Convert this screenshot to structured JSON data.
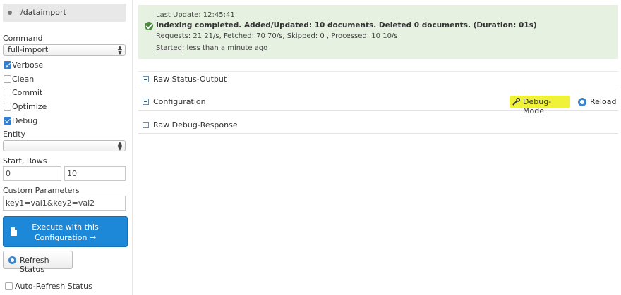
{
  "sidebar": {
    "core_name": "/dataimport",
    "command_label": "Command",
    "command_value": "full-import",
    "checkboxes": [
      {
        "label": "Verbose",
        "checked": true
      },
      {
        "label": "Clean",
        "checked": false
      },
      {
        "label": "Commit",
        "checked": false
      },
      {
        "label": "Optimize",
        "checked": false
      },
      {
        "label": "Debug",
        "checked": true
      }
    ],
    "entity_label": "Entity",
    "entity_value": "",
    "start_rows_label": "Start, Rows",
    "start_value": "0",
    "rows_value": "10",
    "custom_params_label": "Custom Parameters",
    "custom_params_value": "key1=val1&key2=val2",
    "execute_line1": "Execute with this",
    "execute_line2": "Configuration →",
    "refresh_label": "Refresh Status",
    "auto_refresh_label": "Auto-Refresh Status",
    "auto_refresh_checked": false
  },
  "status": {
    "last_update_label": "Last Update:",
    "last_update_time": "12:45:41",
    "headline": "Indexing completed. Added/Updated: 10 documents. Deleted 0 documents. (Duration: 01s)",
    "requests_label": "Requests",
    "requests_value": ": 21 21/s,",
    "fetched_label": "Fetched",
    "fetched_value": ": 70 70/s,",
    "skipped_label": "Skipped",
    "skipped_value": ": 0 ,",
    "processed_label": "Processed",
    "processed_value": ": 10 10/s",
    "started_label": "Started",
    "started_value": ": less than a minute ago",
    "accent_color": "#e6f1e1"
  },
  "sections": [
    {
      "title": "Raw Status-Output"
    },
    {
      "title": "Configuration",
      "debug_mode_label": "Debug-Mode",
      "reload_label": "Reload"
    },
    {
      "title": "Raw Debug-Response"
    }
  ]
}
